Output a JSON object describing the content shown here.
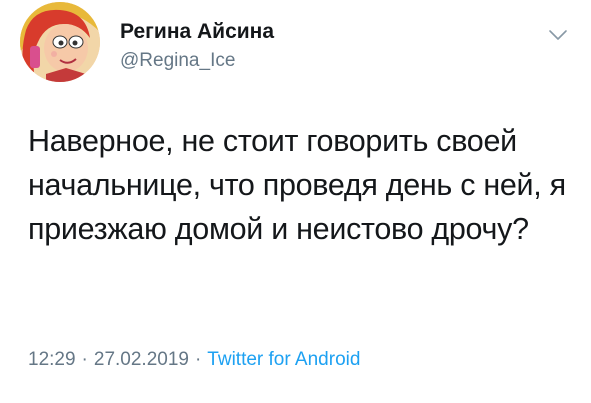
{
  "author": {
    "display_name": "Регина Айсина",
    "handle": "@Regina_Ice"
  },
  "tweet": {
    "text": "Наверное, не стоит говорить своей начальнице, что проведя день с ней, я приезжаю домой и неистово дрочу?",
    "time": "12:29",
    "date": "27.02.2019",
    "separator": "·",
    "source": "Twitter for Android"
  },
  "icons": {
    "menu": "chevron-down-icon",
    "avatar": "cartoon-character-avatar"
  },
  "colors": {
    "text": "#14171a",
    "secondary": "#657786",
    "link": "#1da1f2",
    "background": "#ffffff"
  }
}
